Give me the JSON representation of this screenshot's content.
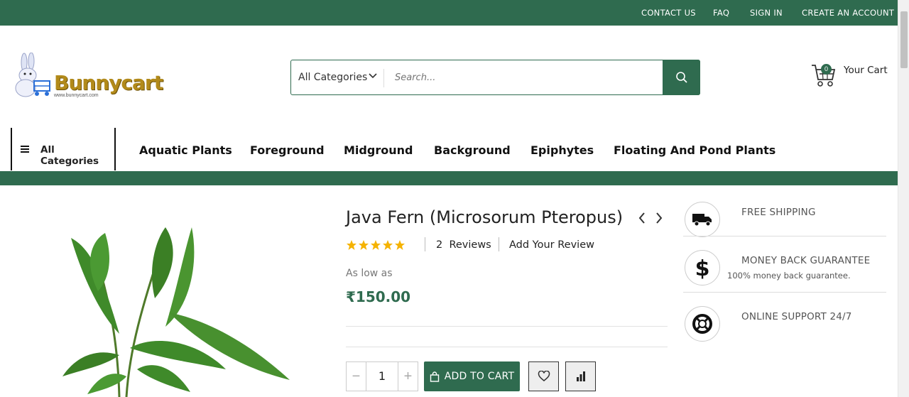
{
  "topbar": {
    "links": [
      "CONTACT US",
      "FAQ",
      "SIGN IN",
      "CREATE AN ACCOUNT"
    ]
  },
  "header": {
    "logo_text": "Bunnycart",
    "logo_url": "www.bunnycart.com",
    "search": {
      "category": "All Categories",
      "placeholder": "Search..."
    },
    "cart": {
      "count": "0",
      "label": "Your Cart"
    }
  },
  "nav": {
    "all_categories": "All Categories",
    "items": [
      "Aquatic Plants",
      "Foreground",
      "Midground",
      "Background",
      "Epiphytes",
      "Floating And Pond Plants"
    ]
  },
  "product": {
    "title": "Java Fern (Microsorum Pteropus)",
    "rating_stars": 5,
    "reviews_count": "2",
    "reviews_label": "Reviews",
    "add_review": "Add Your Review",
    "as_low_as": "As low as",
    "price": "₹150.00",
    "quantity": "1",
    "add_to_cart": "ADD TO CART"
  },
  "features": [
    {
      "title": "FREE SHIPPING",
      "subtitle": "",
      "icon": "truck-icon"
    },
    {
      "title": "MONEY BACK GUARANTEE",
      "subtitle": "100% money back guarantee.",
      "icon": "dollar-icon"
    },
    {
      "title": "ONLINE SUPPORT 24/7",
      "subtitle": "",
      "icon": "lifebuoy-icon"
    }
  ],
  "colors": {
    "brand_green": "#2f6b4f",
    "star_gold": "#f5b301"
  }
}
